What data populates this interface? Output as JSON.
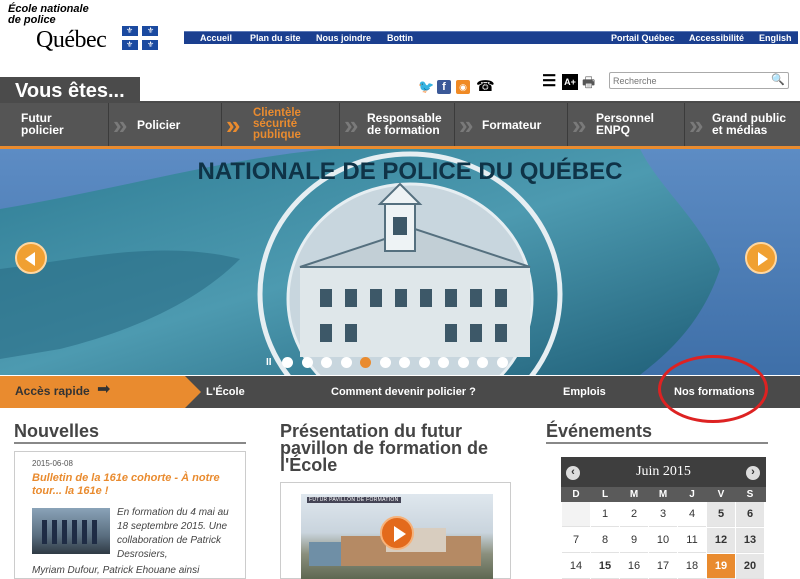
{
  "header": {
    "school_line1": "École nationale",
    "school_line2": "de police",
    "brand": "Québec"
  },
  "topbar": {
    "links": [
      "Accueil",
      "Plan du site",
      "Nous joindre",
      "Bottin",
      "Portail Québec",
      "Accessibilité",
      "English"
    ]
  },
  "band": {
    "vous": "Vous êtes...",
    "search_placeholder": "Recherche",
    "social": [
      "twitter-icon",
      "facebook-icon",
      "rss-icon",
      "phone-icon"
    ],
    "font_tool": "A+"
  },
  "profile_nav": [
    {
      "line1": "Futur",
      "line2": "policier",
      "line3": ""
    },
    {
      "line1": "Policier",
      "line2": "",
      "line3": ""
    },
    {
      "line1": "Clientèle",
      "line2": "sécurité",
      "line3": "publique"
    },
    {
      "line1": "Responsable",
      "line2": "de formation",
      "line3": ""
    },
    {
      "line1": "Formateur",
      "line2": "",
      "line3": ""
    },
    {
      "line1": "Personnel",
      "line2": "ENPQ",
      "line3": ""
    },
    {
      "line1": "Grand public",
      "line2": "et médias",
      "line3": ""
    }
  ],
  "hero": {
    "flag_text": "NATIONALE DE POLICE DU QUÉBEC",
    "slide_count": 12,
    "active_slide": 4,
    "pause": "II"
  },
  "quick_access": {
    "label": "Accès rapide",
    "links": [
      "L'École",
      "Comment devenir policier ?",
      "Emplois",
      "Nos formations"
    ]
  },
  "news": {
    "title": "Nouvelles",
    "date": "2015-06-08",
    "headline": "Bulletin de la 161e cohorte - À notre tour... la 161e !",
    "excerpt": "En formation du 4 mai au 18 septembre 2015. Une collaboration de Patrick Desrosiers,",
    "excerpt2": "Myriam Dufour, Patrick Ehouane ainsi"
  },
  "promo": {
    "title_line1": "Présentation du futur",
    "title_line2": "pavillon de formation de",
    "title_line3": "l'École",
    "image_caption": "FUTUR PAVILLON DE FORMATION"
  },
  "events": {
    "title": "Événements",
    "month": "Juin 2015",
    "weekdays": [
      "D",
      "L",
      "M",
      "M",
      "J",
      "V",
      "S"
    ],
    "rows": [
      [
        "",
        "1",
        "2",
        "3",
        "4",
        "5",
        "6"
      ],
      [
        "7",
        "8",
        "9",
        "10",
        "11",
        "12",
        "13"
      ],
      [
        "14",
        "15",
        "16",
        "17",
        "18",
        "19",
        "20"
      ]
    ],
    "highlight_day": "19"
  }
}
